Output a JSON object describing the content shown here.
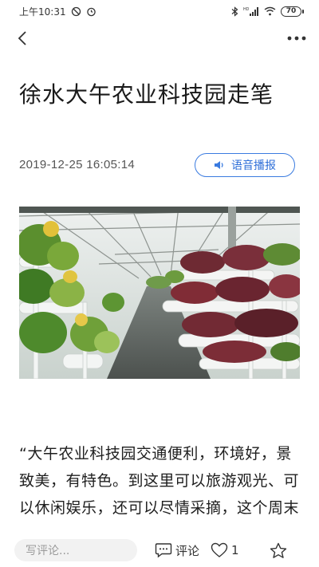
{
  "status_bar": {
    "time": "上午10:31",
    "battery": "70",
    "signal_label": "HD"
  },
  "nav": {
    "back_icon": "chevron-left-icon",
    "more_icon": "more-dots-icon"
  },
  "article": {
    "title": "徐水大午农业科技园走笔",
    "date": "2019-12-25 16:05:14",
    "voice_label": "语音播报",
    "image_alt": "greenhouse-vegetables",
    "body": "“大午农业科技园交通便利，环境好，景致美，有特色。到这里可以旅游观光、可以休闲娱乐，还可以尽情采摘，这个周末"
  },
  "bottom_bar": {
    "comment_placeholder": "写评论...",
    "comment_label": "评论",
    "like_count": "1"
  },
  "colors": {
    "accent": "#3a7be0",
    "text": "#1a1a1a",
    "muted": "#9a9a9a"
  }
}
